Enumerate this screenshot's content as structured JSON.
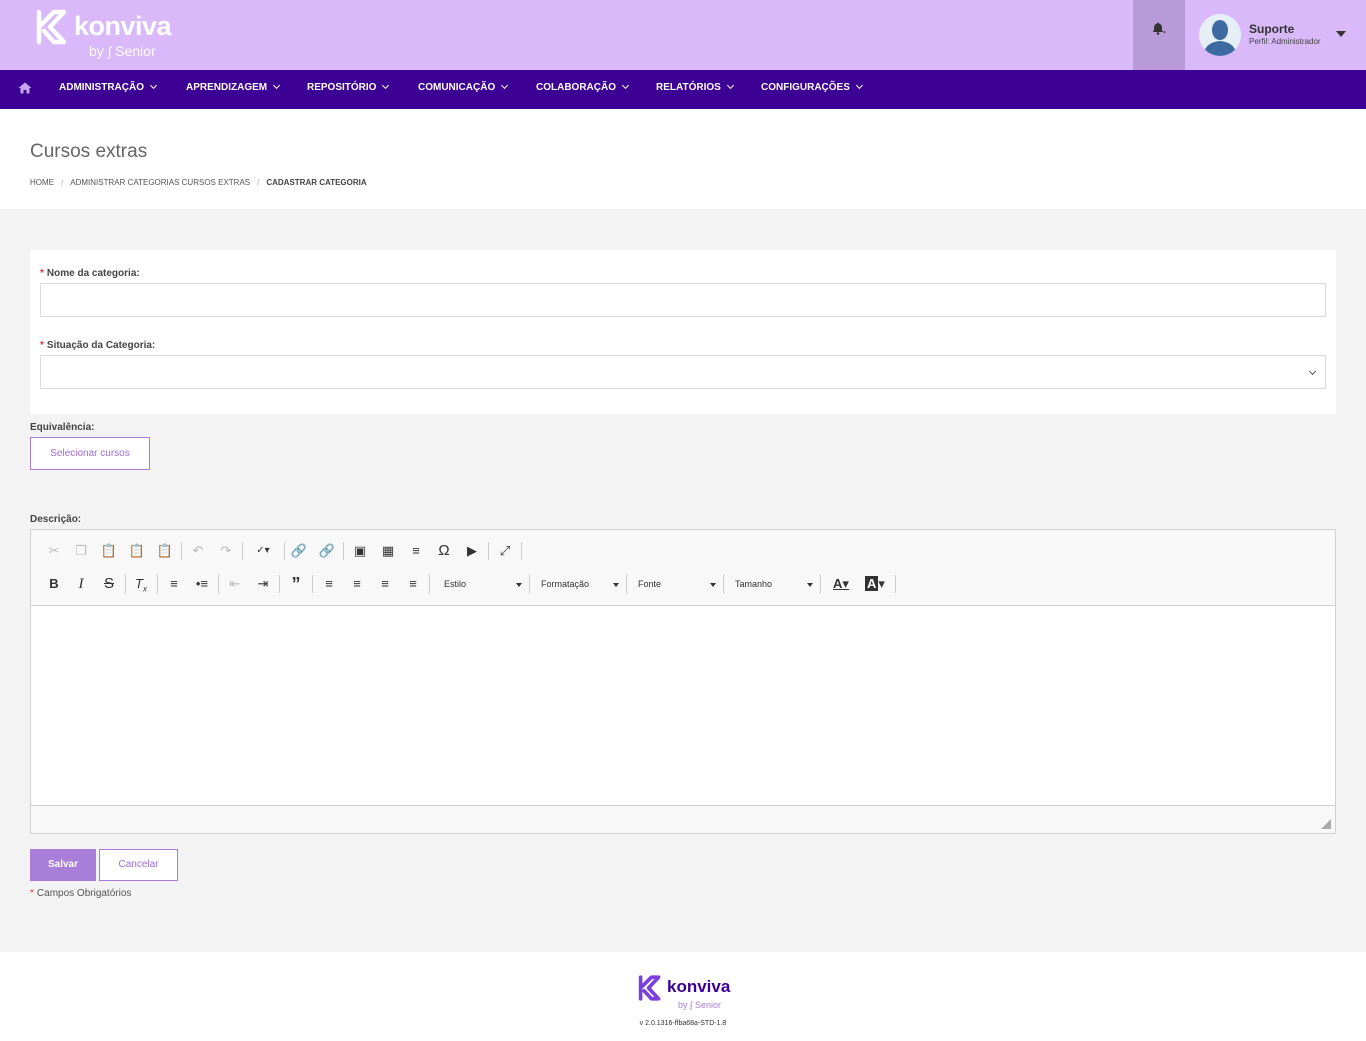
{
  "brand": {
    "name": "konviva",
    "by": "by",
    "by_company": "Senior"
  },
  "user": {
    "name": "Suporte",
    "role": "Perfil: Administrador"
  },
  "nav": {
    "items": [
      {
        "label": "ADMINISTRAÇÃO"
      },
      {
        "label": "APRENDIZAGEM"
      },
      {
        "label": "REPOSITÓRIO"
      },
      {
        "label": "COMUNICAÇÃO"
      },
      {
        "label": "COLABORAÇÃO"
      },
      {
        "label": "RELATÓRIOS"
      },
      {
        "label": "CONFIGURAÇÕES"
      }
    ]
  },
  "page": {
    "title": "Cursos extras"
  },
  "breadcrumb": {
    "home": "HOME",
    "parent": "ADMINISTRAR CATEGORIAS CURSOS EXTRAS",
    "current": "CADASTRAR CATEGORIA"
  },
  "form": {
    "required_mark": "*",
    "name_label": "Nome da categoria:",
    "name_value": "",
    "status_label": "Situação da Categoria:",
    "status_value": "",
    "equivalence_label": "Equivalência:",
    "select_courses_button": "Selecionar cursos",
    "description_label": "Descrição:"
  },
  "editor": {
    "combos": {
      "style": "Estilo",
      "format": "Formatação",
      "font": "Fonte",
      "size": "Tamanho"
    }
  },
  "actions": {
    "save": "Salvar",
    "cancel": "Cancelar",
    "required_note": "Campos Obrigatórios"
  },
  "footer": {
    "version": "v 2.0.1316-ffba68a-STD-1.8"
  },
  "colors": {
    "header_bg": "#d9b9fa",
    "nav_bg": "#3c0094",
    "accent": "#a87ed8"
  }
}
